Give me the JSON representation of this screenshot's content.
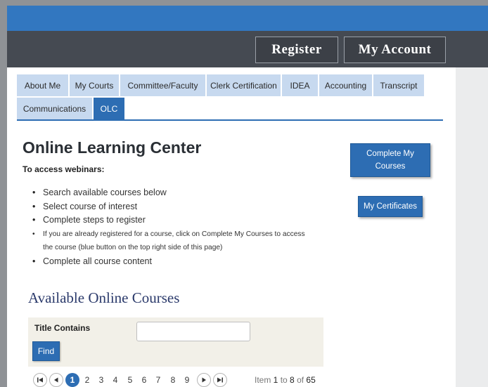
{
  "header": {
    "register_label": "Register",
    "account_label": "My Account"
  },
  "tabs": [
    {
      "label": "About Me"
    },
    {
      "label": "My Courts"
    },
    {
      "label": "Committee/Faculty"
    },
    {
      "label": "Clerk Certification"
    },
    {
      "label": "IDEA"
    },
    {
      "label": "Accounting"
    },
    {
      "label": "Transcript"
    },
    {
      "label": "Communications"
    },
    {
      "label": "OLC",
      "active": true
    }
  ],
  "main": {
    "title": "Online Learning Center",
    "access_label": "To access webinars:",
    "bullets": [
      "Search available courses below",
      "Select course of interest",
      "Complete steps to register",
      "If you are already registered for a course, click on Complete My Courses to access",
      "the course (blue button on the top right side of this page)",
      "Complete all course content"
    ],
    "section_title": "Available Online Courses"
  },
  "side": {
    "complete_courses_label": "Complete My Courses",
    "certificates_label": "My Certificates"
  },
  "filter": {
    "title_label": "Title Contains",
    "title_value": "",
    "find_label": "Find"
  },
  "pager": {
    "pages": [
      "1",
      "2",
      "3",
      "4",
      "5",
      "6",
      "7",
      "8",
      "9"
    ],
    "current_page": "1",
    "item_prefix": "Item ",
    "item_from": "1",
    "item_to_word": " to ",
    "item_to": "8",
    "item_of_word": " of ",
    "item_total": "65"
  },
  "colors": {
    "accent": "#2d6db3",
    "top_strip": "#3277c0",
    "header_bar": "#454a52",
    "tab_bg": "#c7d9ef"
  }
}
